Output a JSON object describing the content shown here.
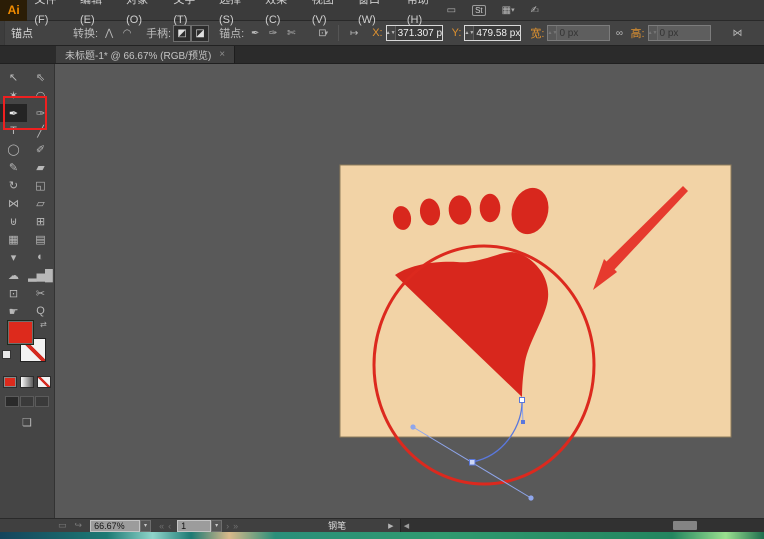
{
  "colors": {
    "shape_red": "#d8271d",
    "circle_red": "#dc291e",
    "arrow_red": "#e63a2e",
    "artboard_tan": "#f2d3a6",
    "artboard_edge": "#8d7c5c",
    "path_blue": "#5a78dd",
    "handle_blue": "#8fa6ec",
    "anchor_fill": "#ffffff",
    "selected_anchor_fill": "#cdd7f5",
    "highlight_red": "#ee2020",
    "accent_orange": "#e0922f"
  },
  "app": {
    "logo": "Ai"
  },
  "menu": {
    "items": [
      "文件(F)",
      "编辑(E)",
      "对象(O)",
      "文字(T)",
      "选择(S)",
      "效果(C)",
      "视图(V)",
      "窗口(W)",
      "帮助(H)"
    ]
  },
  "appbar": {
    "stock_label": "St"
  },
  "glyphs": {
    "arrange_documents": "▭",
    "workspace": "▦",
    "extra_hand": "✍",
    "dropdown": "▾",
    "swap": "⇄",
    "first": "«",
    "prev": "‹",
    "next": "›",
    "last": "»",
    "popup": "▶",
    "scroll_left": "◀",
    "status_a": "▭",
    "status_b": "↪"
  },
  "control_bar": {
    "panel_label": "锚点",
    "convert_label": "转换:",
    "handles_label": "手柄:",
    "anchors_label": "锚点:",
    "x_label": "X:",
    "x_value": "371.307 px",
    "y_label": "Y:",
    "y_value": "479.58 px",
    "w_label": "宽:",
    "w_value": "0 px",
    "h_label": "高:",
    "h_value": "0 px",
    "icons": {
      "convert_corner": "⋀",
      "convert_smooth": "◠",
      "handle_show": "◩",
      "handle_hide": "◪",
      "anchor_add": "✒",
      "anchor_smooth": "✑",
      "anchor_cut": "✄",
      "clip_box": "⊡",
      "align": "↦",
      "link": "∞",
      "transform": "⋈"
    }
  },
  "tab": {
    "title": "未标题-1* @ 66.67% (RGB/预览)",
    "close_glyph": "×"
  },
  "toolbar": {
    "tools": [
      {
        "name": "selection-tool",
        "glyph": "↖"
      },
      {
        "name": "direct-selection-tool",
        "glyph": "⇖"
      },
      {
        "name": "magic-wand-tool",
        "glyph": "✶"
      },
      {
        "name": "lasso-tool",
        "glyph": "◠"
      },
      {
        "name": "pen-tool",
        "glyph": "✒",
        "active": true
      },
      {
        "name": "curvature-tool",
        "glyph": "✑"
      },
      {
        "name": "type-tool",
        "glyph": "T"
      },
      {
        "name": "line-segment-tool",
        "glyph": "╱"
      },
      {
        "name": "ellipse-tool",
        "glyph": "◯"
      },
      {
        "name": "paintbrush-tool",
        "glyph": "✐"
      },
      {
        "name": "pencil-tool",
        "glyph": "✎"
      },
      {
        "name": "eraser-tool",
        "glyph": "▰"
      },
      {
        "name": "rotate-tool",
        "glyph": "↻"
      },
      {
        "name": "scale-tool",
        "glyph": "◱"
      },
      {
        "name": "width-tool",
        "glyph": "⋈"
      },
      {
        "name": "free-transform-tool",
        "glyph": "▱"
      },
      {
        "name": "shape-builder-tool",
        "glyph": "⊎"
      },
      {
        "name": "perspective-grid-tool",
        "glyph": "⊞"
      },
      {
        "name": "mesh-tool",
        "glyph": "▦"
      },
      {
        "name": "gradient-tool",
        "glyph": "▤"
      },
      {
        "name": "eyedropper-tool",
        "glyph": "▾"
      },
      {
        "name": "blend-tool",
        "glyph": "◐"
      },
      {
        "name": "symbol-sprayer-tool",
        "glyph": "☁"
      },
      {
        "name": "column-graph-tool",
        "glyph": "▂▅█"
      },
      {
        "name": "artboard-tool",
        "glyph": "⊡"
      },
      {
        "name": "slice-tool",
        "glyph": "✂"
      },
      {
        "name": "hand-tool",
        "glyph": "☛"
      },
      {
        "name": "zoom-tool",
        "glyph": "Q"
      }
    ],
    "screen_mode_glyph": "❏"
  },
  "statusbar": {
    "zoom_value": "66.67%",
    "artboard_value": "1",
    "tool_name": "钢笔"
  }
}
